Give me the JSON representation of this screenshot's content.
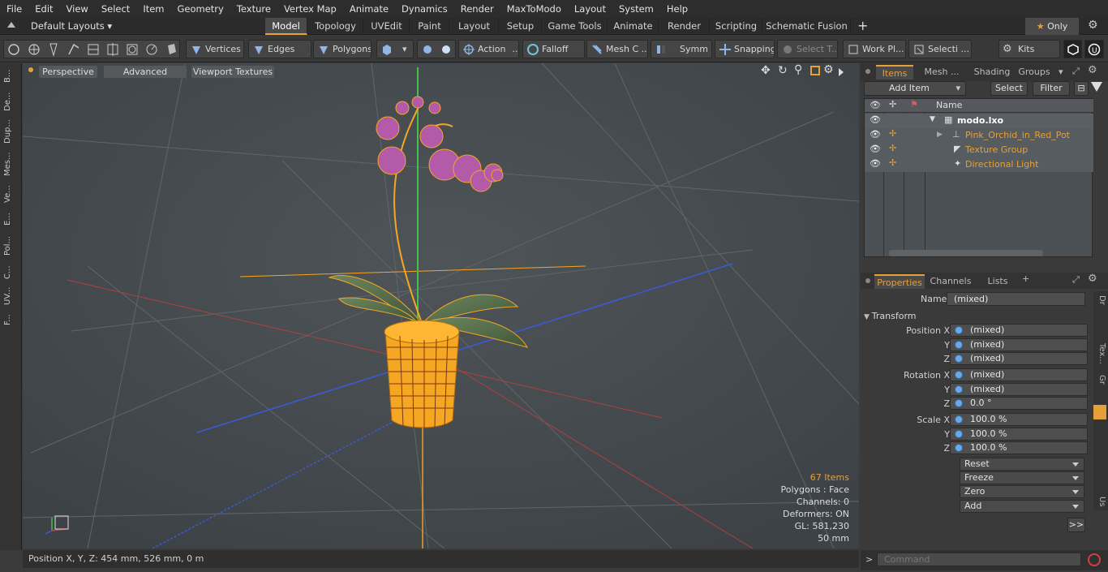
{
  "menu": [
    "File",
    "Edit",
    "View",
    "Select",
    "Item",
    "Geometry",
    "Texture",
    "Vertex Map",
    "Animate",
    "Dynamics",
    "Render",
    "MaxToModo",
    "Layout",
    "System",
    "Help"
  ],
  "layouts_label": "Default Layouts",
  "layout_tabs": [
    "Model",
    "Topology",
    "UVEdit",
    "Paint",
    "Layout",
    "Setup",
    "Game Tools",
    "Animate",
    "Render",
    "Scripting",
    "Schematic Fusion"
  ],
  "only_label": "Only",
  "toolbar": {
    "vertices": "Vertices",
    "edges": "Edges",
    "polygons": "Polygons",
    "action": "Action",
    "falloff": "Falloff",
    "meshc": "Mesh C ...",
    "symm": "Symm ...",
    "snapping": "Snapping",
    "selectt": "Select T...",
    "workpl": "Work Pl...",
    "selecti": "Selecti ...",
    "kits": "Kits"
  },
  "left_tabs": [
    "B...",
    "De...",
    "Dup...",
    "Mes...",
    "Ve...",
    "E...",
    "Pol...",
    "C...",
    "UV...",
    "F..."
  ],
  "viewport": {
    "perspective": "Perspective",
    "advanced": "Advanced",
    "textures": "Viewport Textures",
    "stats": {
      "items": "67 Items",
      "polygons": "Polygons : Face",
      "channels": "Channels: 0",
      "deformers": "Deformers: ON",
      "gl": "GL: 581,230",
      "size": "50 mm"
    }
  },
  "status_text": "Position X, Y, Z:  454 mm, 526 mm, 0 m",
  "items_panel": {
    "tabs": [
      "Items",
      "Mesh ...",
      "Shading",
      "Groups"
    ],
    "add_item": "Add Item",
    "select": "Select",
    "filter": "Filter",
    "col_name": "Name",
    "tree": [
      {
        "name": "modo.lxo"
      },
      {
        "name": "Pink_Orchid_in_Red_Pot"
      },
      {
        "name": "Texture Group"
      },
      {
        "name": "Directional Light"
      }
    ]
  },
  "props": {
    "tabs": [
      "Properties",
      "Channels",
      "Lists"
    ],
    "name_label": "Name",
    "name_value": "(mixed)",
    "section": "Transform",
    "rows": [
      {
        "label": "Position X",
        "value": "(mixed)"
      },
      {
        "label": "Y",
        "value": "(mixed)"
      },
      {
        "label": "Z",
        "value": "(mixed)"
      },
      {
        "label": "Rotation X",
        "value": "(mixed)"
      },
      {
        "label": "Y",
        "value": "(mixed)"
      },
      {
        "label": "Z",
        "value": "0.0 °"
      },
      {
        "label": "Scale X",
        "value": "100.0 %"
      },
      {
        "label": "Y",
        "value": "100.0 %"
      },
      {
        "label": "Z",
        "value": "100.0 %"
      }
    ],
    "actions": [
      "Reset",
      "Freeze",
      "Zero",
      "Add"
    ],
    "more": ">>",
    "side_tabs": [
      "Dr",
      "Tex...",
      "Gr",
      "Us"
    ]
  },
  "command_placeholder": "Command",
  "colors": {
    "accent": "#e6a038",
    "selected_wire": "#f5a623",
    "flower": "#b35aa8",
    "leaf": "#4f6b45"
  }
}
